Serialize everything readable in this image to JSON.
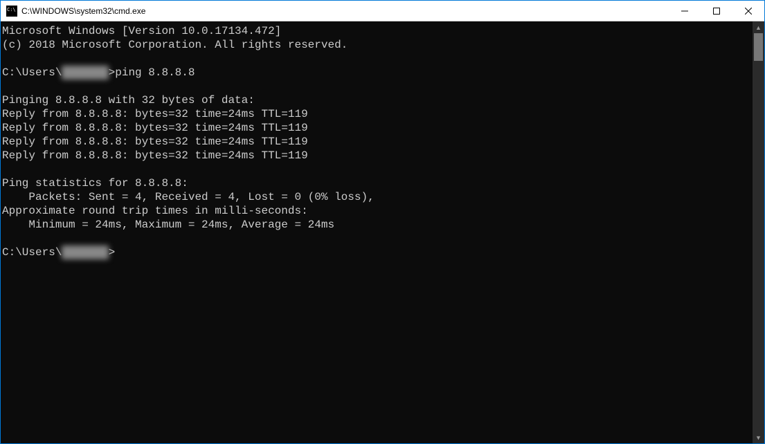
{
  "titlebar": {
    "title": "C:\\WINDOWS\\system32\\cmd.exe"
  },
  "console": {
    "header1": "Microsoft Windows [Version 10.0.17134.472]",
    "header2": "(c) 2018 Microsoft Corporation. All rights reserved.",
    "prompt1_prefix": "C:\\Users\\",
    "prompt1_user_masked": "XXXXXXX",
    "prompt1_suffix": ">",
    "command1": "ping 8.8.8.8",
    "ping_header": "Pinging 8.8.8.8 with 32 bytes of data:",
    "reply1": "Reply from 8.8.8.8: bytes=32 time=24ms TTL=119",
    "reply2": "Reply from 8.8.8.8: bytes=32 time=24ms TTL=119",
    "reply3": "Reply from 8.8.8.8: bytes=32 time=24ms TTL=119",
    "reply4": "Reply from 8.8.8.8: bytes=32 time=24ms TTL=119",
    "stats_header": "Ping statistics for 8.8.8.8:",
    "stats_packets": "    Packets: Sent = 4, Received = 4, Lost = 0 (0% loss),",
    "stats_rtt_header": "Approximate round trip times in milli-seconds:",
    "stats_rtt": "    Minimum = 24ms, Maximum = 24ms, Average = 24ms",
    "prompt2_prefix": "C:\\Users\\",
    "prompt2_user_masked": "XXXXXXX",
    "prompt2_suffix": ">"
  }
}
